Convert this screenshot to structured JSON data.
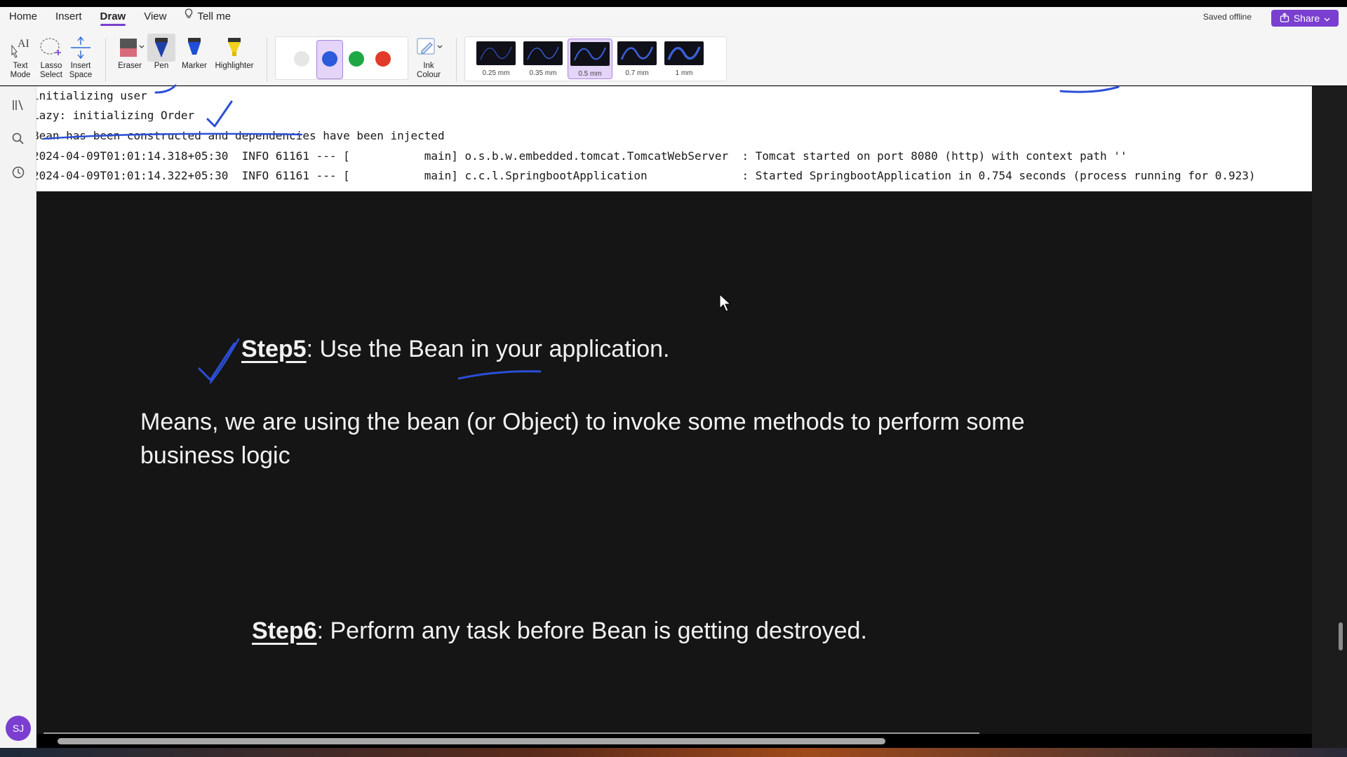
{
  "ribbon": {
    "tabs": [
      {
        "label": "Home"
      },
      {
        "label": "Insert"
      },
      {
        "label": "Draw"
      },
      {
        "label": "View"
      }
    ],
    "tell_me": "Tell me",
    "saved_status": "Saved offline",
    "share_label": "Share",
    "tools": {
      "text_mode": "Text Mode",
      "lasso_select": "Lasso Select",
      "insert_space": "Insert Space",
      "eraser": "Eraser",
      "pen": "Pen",
      "marker": "Marker",
      "highlighter": "Highlighter",
      "ink_colour": "Ink Colour"
    },
    "colors": [
      "#e6e6e6",
      "#2b5bdc",
      "#1ea845",
      "#e23a2a"
    ],
    "pen_sizes": [
      "0.25 mm",
      "0.35 mm",
      "0.5 mm",
      "0.7 mm",
      "1 mm"
    ],
    "selected_pen_size": "0.5 mm"
  },
  "console": {
    "lines": [
      "initializing user",
      "Lazy: initializing Order",
      "Bean has been constructed and dependencies have been injected",
      "2024-04-09T01:01:14.318+05:30  INFO 61161 --- [           main] o.s.b.w.embedded.tomcat.TomcatWebServer  : Tomcat started on port 8080 (http) with context path ''",
      "2024-04-09T01:01:14.322+05:30  INFO 61161 --- [           main] c.c.l.SpringbootApplication              : Started SpringbootApplication in 0.754 seconds (process running for 0.923)"
    ]
  },
  "slide": {
    "step5_label": "Step5",
    "step5_text": ": Use the Bean in your application.",
    "means_line1": "Means, we are using the bean (or Object) to invoke some methods to perform some",
    "means_line2": "business logic",
    "step6_label": "Step6",
    "step6_text": ": Perform any task before Bean is getting destroyed."
  },
  "user": {
    "initials": "SJ"
  },
  "accent": "#7a3fd0",
  "ink_color": "#2b4fd6"
}
